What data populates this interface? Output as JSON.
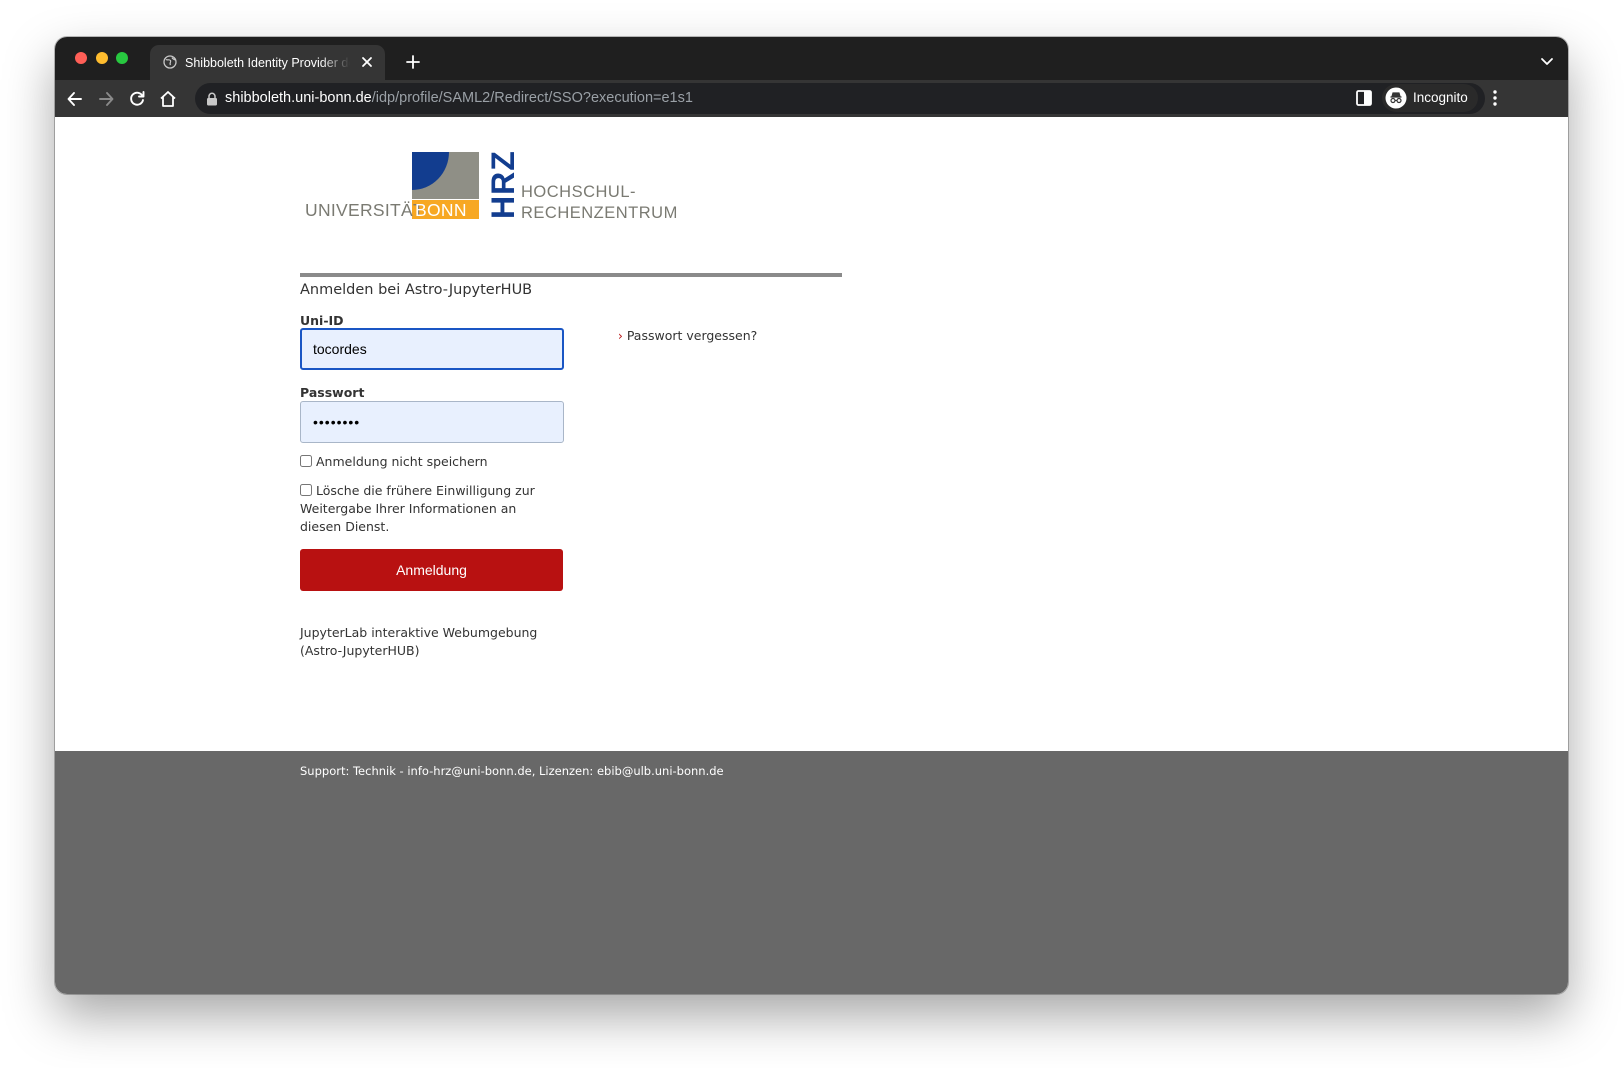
{
  "browser": {
    "tab_title": "Shibboleth Identity Provider der Universität Bonn",
    "url_host": "shibboleth.uni-bonn.de",
    "url_path": "/idp/profile/SAML2/Redirect/SSO?execution=e1s1",
    "profile_label": "Incognito"
  },
  "logo": {
    "university_word": "UNIVERSITÄT",
    "bonn_word": "BONN",
    "hrz_word": "HRZ",
    "hrz_line1": "HOCHSCHUL-",
    "hrz_line2": "RECHENZENTRUM",
    "colors": {
      "blue": "#123d8f",
      "gray": "#8f8f86",
      "orange": "#f7a823",
      "text": "#7a7a72"
    }
  },
  "form": {
    "title": "Anmelden bei Astro-JupyterHUB",
    "uid_label": "Uni-ID",
    "uid_value": "tocordes",
    "password_label": "Passwort",
    "password_value": "••••••••",
    "no_store_label": "Anmeldung nicht speichern",
    "revoke_consent_label": "Lösche die frühere Einwilligung zur Weitergabe Ihrer Informationen an diesen Dienst.",
    "submit_label": "Anmeldung",
    "forgot_label": "Passwort vergessen?",
    "service_description": "JupyterLab interaktive Webumgebung (Astro-JupyterHUB)"
  },
  "footer": {
    "support_text": "Support: Technik - info-hrz@uni-bonn.de, Lizenzen: ebib@ulb.uni-bonn.de"
  }
}
